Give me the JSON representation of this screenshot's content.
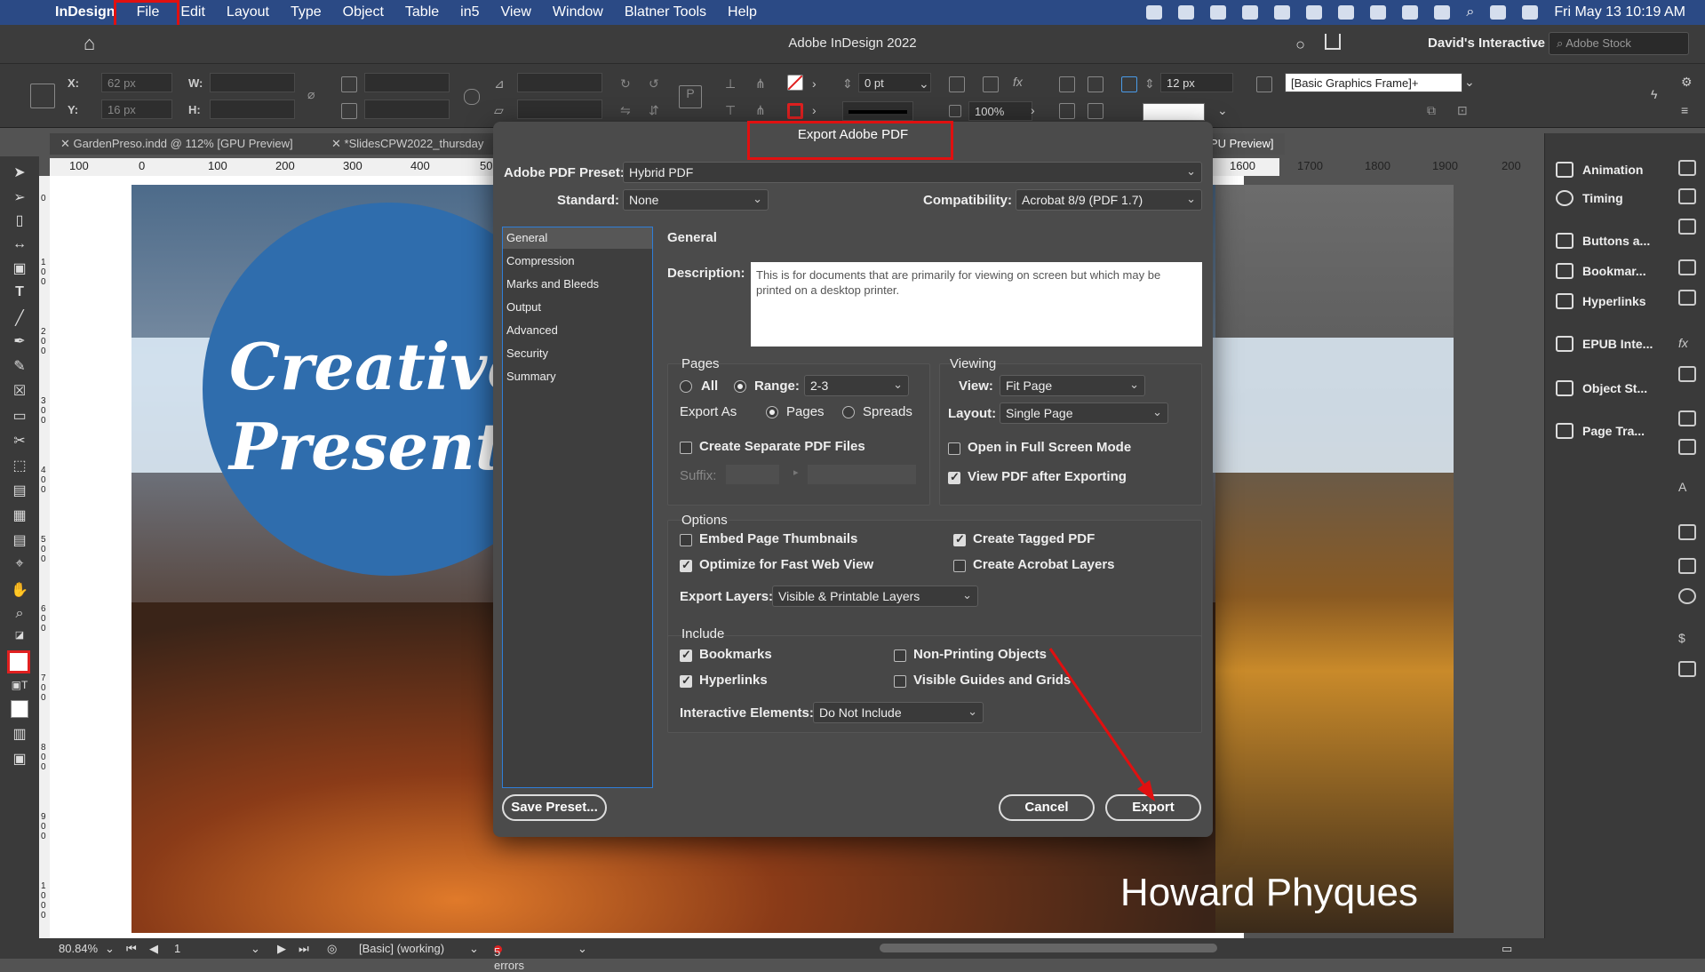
{
  "menubar": {
    "items": [
      "InDesign",
      "File",
      "Edit",
      "Layout",
      "Type",
      "Object",
      "Table",
      "in5",
      "View",
      "Window",
      "Blatner Tools",
      "Help"
    ],
    "datetime": "Fri May 13  10:19 AM"
  },
  "app": {
    "title": "Adobe InDesign 2022",
    "workspace": "David's Interactive",
    "stock_placeholder": "Adobe Stock"
  },
  "control": {
    "x_label": "X:",
    "x_value": "62 px",
    "y_label": "Y:",
    "y_value": "16 px",
    "w_label": "W:",
    "h_label": "H:",
    "stroke_weight": "0 pt",
    "opacity": "100%",
    "gutter": "12 px",
    "object_style": "[Basic Graphics Frame]+"
  },
  "doc_tabs": [
    "GardenPreso.indd @ 112% [GPU Preview]",
    "*SlidesCPW2022_thursday",
    "PU Preview]"
  ],
  "ruler": {
    "ticks": [
      "100",
      "0",
      "100",
      "200",
      "300",
      "400",
      "50",
      "1600",
      "1700",
      "1800",
      "1900",
      "200"
    ],
    "vticks": [
      "0",
      "1 0 0",
      "2 0 0",
      "3 0 0",
      "4 0 0",
      "5 0 0",
      "6 0 0",
      "7 0 0",
      "8 0 0",
      "9 0 0",
      "1 0 0 0"
    ]
  },
  "canvas": {
    "circle_text": "CreativeP\nPresentati",
    "author": "Howard Phyques"
  },
  "right_panel": {
    "items": [
      "Animation",
      "Timing",
      "Buttons a...",
      "Bookmar...",
      "Hyperlinks",
      "EPUB Inte...",
      "Object St...",
      "Page Tra..."
    ]
  },
  "status": {
    "zoom": "80.84%",
    "page": "1",
    "preflight_profile": "[Basic] (working)",
    "errors": "5 errors"
  },
  "dialog": {
    "title": "Export Adobe PDF",
    "preset_label": "Adobe PDF Preset:",
    "preset_value": "Hybrid PDF",
    "standard_label": "Standard:",
    "standard_value": "None",
    "compat_label": "Compatibility:",
    "compat_value": "Acrobat 8/9 (PDF 1.7)",
    "categories": [
      "General",
      "Compression",
      "Marks and Bleeds",
      "Output",
      "Advanced",
      "Security",
      "Summary"
    ],
    "section_title": "General",
    "description_label": "Description:",
    "description": "This is for documents that are primarily for viewing on screen but which may be printed on a desktop printer.",
    "pages": {
      "title": "Pages",
      "all_label": "All",
      "range_label": "Range:",
      "range_value": "2-3",
      "export_as_label": "Export As",
      "pages_label": "Pages",
      "spreads_label": "Spreads",
      "separate_label": "Create Separate PDF Files",
      "suffix_label": "Suffix:"
    },
    "viewing": {
      "title": "Viewing",
      "view_label": "View:",
      "view_value": "Fit Page",
      "layout_label": "Layout:",
      "layout_value": "Single Page",
      "fullscreen_label": "Open in Full Screen Mode",
      "view_after_label": "View PDF after Exporting"
    },
    "options": {
      "title": "Options",
      "embed_thumbs": "Embed Page Thumbnails",
      "optimize_web": "Optimize for Fast Web View",
      "tagged_pdf": "Create Tagged PDF",
      "acrobat_layers": "Create Acrobat Layers",
      "export_layers_label": "Export Layers:",
      "export_layers_value": "Visible & Printable Layers"
    },
    "include": {
      "title": "Include",
      "bookmarks": "Bookmarks",
      "hyperlinks": "Hyperlinks",
      "non_printing": "Non-Printing Objects",
      "guides_grids": "Visible Guides and Grids",
      "interactive_label": "Interactive Elements:",
      "interactive_value": "Do Not Include"
    },
    "buttons": {
      "save_preset": "Save Preset...",
      "cancel": "Cancel",
      "export": "Export"
    }
  },
  "colors": {
    "menubar": "#2b4a85",
    "dialog_bg": "#4b4b4b",
    "highlight_red": "#e01010",
    "accent_blue": "#2f7ed8"
  }
}
